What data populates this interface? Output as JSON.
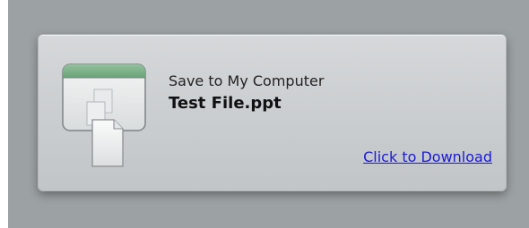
{
  "dialog": {
    "caption": "Save to My Computer",
    "filename": "Test File.ppt",
    "download_link": "Click to Download",
    "icon": "file-download-window-icon"
  },
  "colors": {
    "backdrop": "#9ca1a3",
    "card": "#cdd0d2",
    "window_titlebar": "#7fb38a",
    "link": "#1a1ad6"
  }
}
